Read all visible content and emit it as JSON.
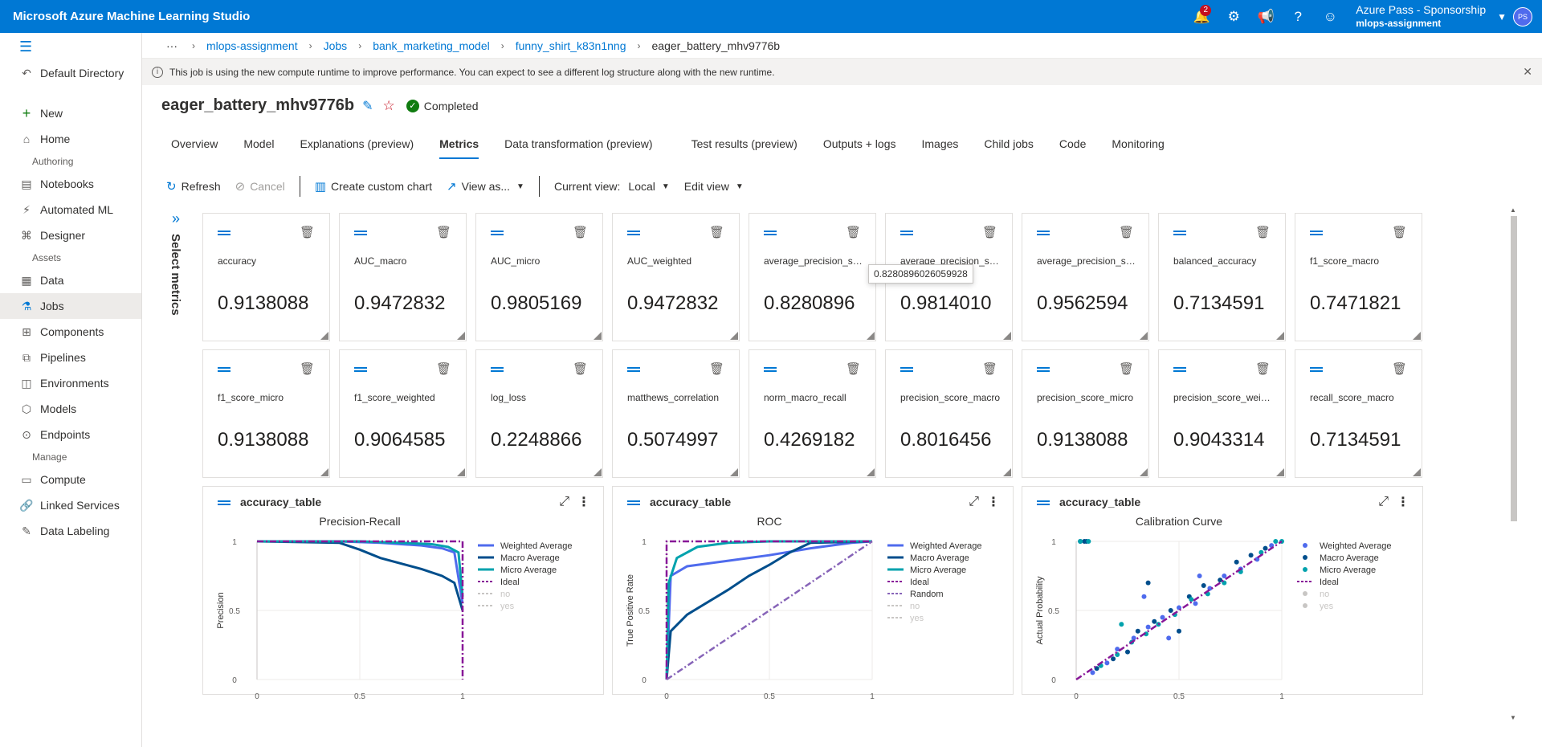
{
  "app": {
    "title": "Microsoft Azure Machine Learning Studio",
    "notification_count": "2",
    "account_name": "Azure Pass - Sponsorship",
    "account_workspace": "mlops-assignment",
    "avatar_initials": "PS"
  },
  "sidebar": {
    "directory": "Default Directory",
    "top_items": [
      {
        "label": "New",
        "icon": "plus-icon"
      },
      {
        "label": "Home",
        "icon": "home-icon"
      }
    ],
    "authoring_label": "Authoring",
    "authoring_items": [
      {
        "label": "Notebooks",
        "icon": "notebook-icon"
      },
      {
        "label": "Automated ML",
        "icon": "automl-icon"
      },
      {
        "label": "Designer",
        "icon": "designer-icon"
      }
    ],
    "assets_label": "Assets",
    "assets_items": [
      {
        "label": "Data",
        "icon": "data-icon"
      },
      {
        "label": "Jobs",
        "icon": "jobs-icon"
      },
      {
        "label": "Components",
        "icon": "components-icon"
      },
      {
        "label": "Pipelines",
        "icon": "pipelines-icon"
      },
      {
        "label": "Environments",
        "icon": "environments-icon"
      },
      {
        "label": "Models",
        "icon": "models-icon"
      },
      {
        "label": "Endpoints",
        "icon": "endpoints-icon"
      }
    ],
    "manage_label": "Manage",
    "manage_items": [
      {
        "label": "Compute",
        "icon": "compute-icon"
      },
      {
        "label": "Linked Services",
        "icon": "link-icon"
      },
      {
        "label": "Data Labeling",
        "icon": "labeling-icon"
      }
    ]
  },
  "breadcrumb": [
    "mlops-assignment",
    "Jobs",
    "bank_marketing_model",
    "funny_shirt_k83n1nng",
    "eager_battery_mhv9776b"
  ],
  "infobar": {
    "text": "This job is using the new compute runtime to improve performance. You can expect to see a different log structure along with the new runtime."
  },
  "job": {
    "name": "eager_battery_mhv9776b",
    "status": "Completed"
  },
  "tabs": [
    "Overview",
    "Model",
    "Explanations (preview)",
    "Metrics",
    "Data transformation (preview)",
    "Test results (preview)",
    "Outputs + logs",
    "Images",
    "Child jobs",
    "Code",
    "Monitoring"
  ],
  "toolbar": {
    "refresh": "Refresh",
    "cancel": "Cancel",
    "create_chart": "Create custom chart",
    "view_as": "View as...",
    "current_view_label": "Current view:",
    "current_view_value": "Local",
    "edit_view": "Edit view"
  },
  "select_metrics": "Select metrics",
  "metrics": [
    {
      "name": "accuracy",
      "value": "0.9138088"
    },
    {
      "name": "AUC_macro",
      "value": "0.9472832"
    },
    {
      "name": "AUC_micro",
      "value": "0.9805169"
    },
    {
      "name": "AUC_weighted",
      "value": "0.9472832"
    },
    {
      "name": "average_precision_sco...",
      "value": "0.8280896"
    },
    {
      "name": "average_precision_sco...",
      "value": "0.9814010"
    },
    {
      "name": "average_precision_sco...",
      "value": "0.9562594"
    },
    {
      "name": "balanced_accuracy",
      "value": "0.7134591"
    },
    {
      "name": "f1_score_macro",
      "value": "0.7471821"
    },
    {
      "name": "f1_score_micro",
      "value": "0.9138088"
    },
    {
      "name": "f1_score_weighted",
      "value": "0.9064585"
    },
    {
      "name": "log_loss",
      "value": "0.2248866"
    },
    {
      "name": "matthews_correlation",
      "value": "0.5074997"
    },
    {
      "name": "norm_macro_recall",
      "value": "0.4269182"
    },
    {
      "name": "precision_score_macro",
      "value": "0.8016456"
    },
    {
      "name": "precision_score_micro",
      "value": "0.9138088"
    },
    {
      "name": "precision_score_weigh...",
      "value": "0.9043314"
    },
    {
      "name": "recall_score_macro",
      "value": "0.7134591"
    }
  ],
  "tooltip": "0.8280896026059928",
  "chart_data": [
    {
      "type": "line",
      "card_title": "accuracy_table",
      "title": "Precision-Recall",
      "ylabel": "Precision",
      "xticks": [
        "0",
        "0.5",
        "1"
      ],
      "yticks": [
        "0",
        "0.5",
        "1"
      ],
      "xlim": [
        0,
        1
      ],
      "ylim": [
        0,
        1
      ],
      "legend": [
        "Weighted Average",
        "Macro Average",
        "Micro Average",
        "Ideal",
        "no",
        "yes"
      ],
      "series": [
        {
          "name": "Weighted Average",
          "color": "#4f6bed",
          "x": [
            0,
            0.4,
            0.6,
            0.8,
            0.9,
            0.96,
            1.0
          ],
          "y": [
            1,
            1,
            0.99,
            0.97,
            0.95,
            0.92,
            0.55
          ]
        },
        {
          "name": "Macro Average",
          "color": "#004e8c",
          "x": [
            0,
            0.4,
            0.5,
            0.6,
            0.7,
            0.8,
            0.9,
            0.96,
            1.0
          ],
          "y": [
            1,
            0.99,
            0.94,
            0.88,
            0.84,
            0.8,
            0.75,
            0.7,
            0.5
          ]
        },
        {
          "name": "Micro Average",
          "color": "#00a2ad",
          "x": [
            0,
            0.5,
            0.7,
            0.85,
            0.93,
            0.98,
            1.0
          ],
          "y": [
            1,
            1,
            0.99,
            0.98,
            0.96,
            0.92,
            0.6
          ]
        },
        {
          "name": "Ideal",
          "color": "#881798",
          "x": [
            0,
            1,
            1
          ],
          "y": [
            1,
            1,
            0
          ],
          "dash": true
        }
      ]
    },
    {
      "type": "line",
      "card_title": "accuracy_table",
      "title": "ROC",
      "ylabel": "True Positive Rate",
      "xticks": [
        "0",
        "0.5",
        "1"
      ],
      "yticks": [
        "0",
        "0.5",
        "1"
      ],
      "xlim": [
        0,
        1
      ],
      "ylim": [
        0,
        1
      ],
      "legend": [
        "Weighted Average",
        "Macro Average",
        "Micro Average",
        "Ideal",
        "Random",
        "no",
        "yes"
      ],
      "series": [
        {
          "name": "Weighted Average",
          "color": "#4f6bed",
          "x": [
            0,
            0.02,
            0.1,
            0.3,
            0.5,
            0.7,
            0.9,
            1.0
          ],
          "y": [
            0,
            0.75,
            0.82,
            0.86,
            0.9,
            0.95,
            0.99,
            1
          ]
        },
        {
          "name": "Macro Average",
          "color": "#004e8c",
          "x": [
            0,
            0.02,
            0.1,
            0.2,
            0.3,
            0.4,
            0.5,
            0.6,
            0.7,
            1.0
          ],
          "y": [
            0,
            0.35,
            0.47,
            0.56,
            0.65,
            0.75,
            0.83,
            0.92,
            0.99,
            1
          ]
        },
        {
          "name": "Micro Average",
          "color": "#00a2ad",
          "x": [
            0,
            0.01,
            0.05,
            0.15,
            0.3,
            0.5,
            1.0
          ],
          "y": [
            0,
            0.7,
            0.88,
            0.96,
            0.99,
            1,
            1
          ]
        },
        {
          "name": "Ideal",
          "color": "#881798",
          "x": [
            0,
            0,
            1
          ],
          "y": [
            0,
            1,
            1
          ],
          "dash": true
        },
        {
          "name": "Random",
          "color": "#8764b8",
          "x": [
            0,
            1
          ],
          "y": [
            0,
            1
          ],
          "dash": true
        }
      ]
    },
    {
      "type": "scatter",
      "card_title": "accuracy_table",
      "title": "Calibration Curve",
      "ylabel": "Actual Probability",
      "xticks": [
        "0",
        "0.5",
        "1"
      ],
      "yticks": [
        "0",
        "0.5",
        "1"
      ],
      "xlim": [
        0,
        1
      ],
      "ylim": [
        0,
        1
      ],
      "legend": [
        "Weighted Average",
        "Macro Average",
        "Micro Average",
        "Ideal",
        "no",
        "yes"
      ],
      "series": [
        {
          "name": "Weighted Average",
          "color": "#4f6bed",
          "points": [
            [
              0.08,
              0.05
            ],
            [
              0.15,
              0.12
            ],
            [
              0.2,
              0.22
            ],
            [
              0.28,
              0.3
            ],
            [
              0.35,
              0.38
            ],
            [
              0.42,
              0.45
            ],
            [
              0.5,
              0.52
            ],
            [
              0.58,
              0.55
            ],
            [
              0.65,
              0.66
            ],
            [
              0.72,
              0.75
            ],
            [
              0.8,
              0.8
            ],
            [
              0.88,
              0.87
            ],
            [
              0.95,
              0.97
            ],
            [
              0.33,
              0.6
            ],
            [
              0.45,
              0.3
            ],
            [
              0.6,
              0.75
            ]
          ]
        },
        {
          "name": "Macro Average",
          "color": "#004e8c",
          "points": [
            [
              0.1,
              0.08
            ],
            [
              0.18,
              0.15
            ],
            [
              0.25,
              0.2
            ],
            [
              0.3,
              0.35
            ],
            [
              0.38,
              0.42
            ],
            [
              0.46,
              0.5
            ],
            [
              0.55,
              0.6
            ],
            [
              0.62,
              0.68
            ],
            [
              0.7,
              0.72
            ],
            [
              0.78,
              0.85
            ],
            [
              0.85,
              0.9
            ],
            [
              0.92,
              0.95
            ],
            [
              0.35,
              0.7
            ],
            [
              0.5,
              0.35
            ],
            [
              0.02,
              1
            ],
            [
              0.05,
              1
            ],
            [
              0.04,
              1
            ]
          ]
        },
        {
          "name": "Micro Average",
          "color": "#00a2ad",
          "points": [
            [
              0.12,
              0.1
            ],
            [
              0.2,
              0.18
            ],
            [
              0.27,
              0.27
            ],
            [
              0.34,
              0.33
            ],
            [
              0.4,
              0.4
            ],
            [
              0.48,
              0.47
            ],
            [
              0.56,
              0.58
            ],
            [
              0.64,
              0.62
            ],
            [
              0.72,
              0.7
            ],
            [
              0.8,
              0.78
            ],
            [
              0.9,
              0.92
            ],
            [
              0.97,
              1
            ],
            [
              1,
              1
            ],
            [
              0.02,
              1
            ],
            [
              0.06,
              1
            ],
            [
              0.22,
              0.4
            ]
          ]
        },
        {
          "name": "Ideal",
          "color": "#881798",
          "x": [
            0,
            1
          ],
          "y": [
            0,
            1
          ],
          "dash": true
        }
      ]
    }
  ]
}
